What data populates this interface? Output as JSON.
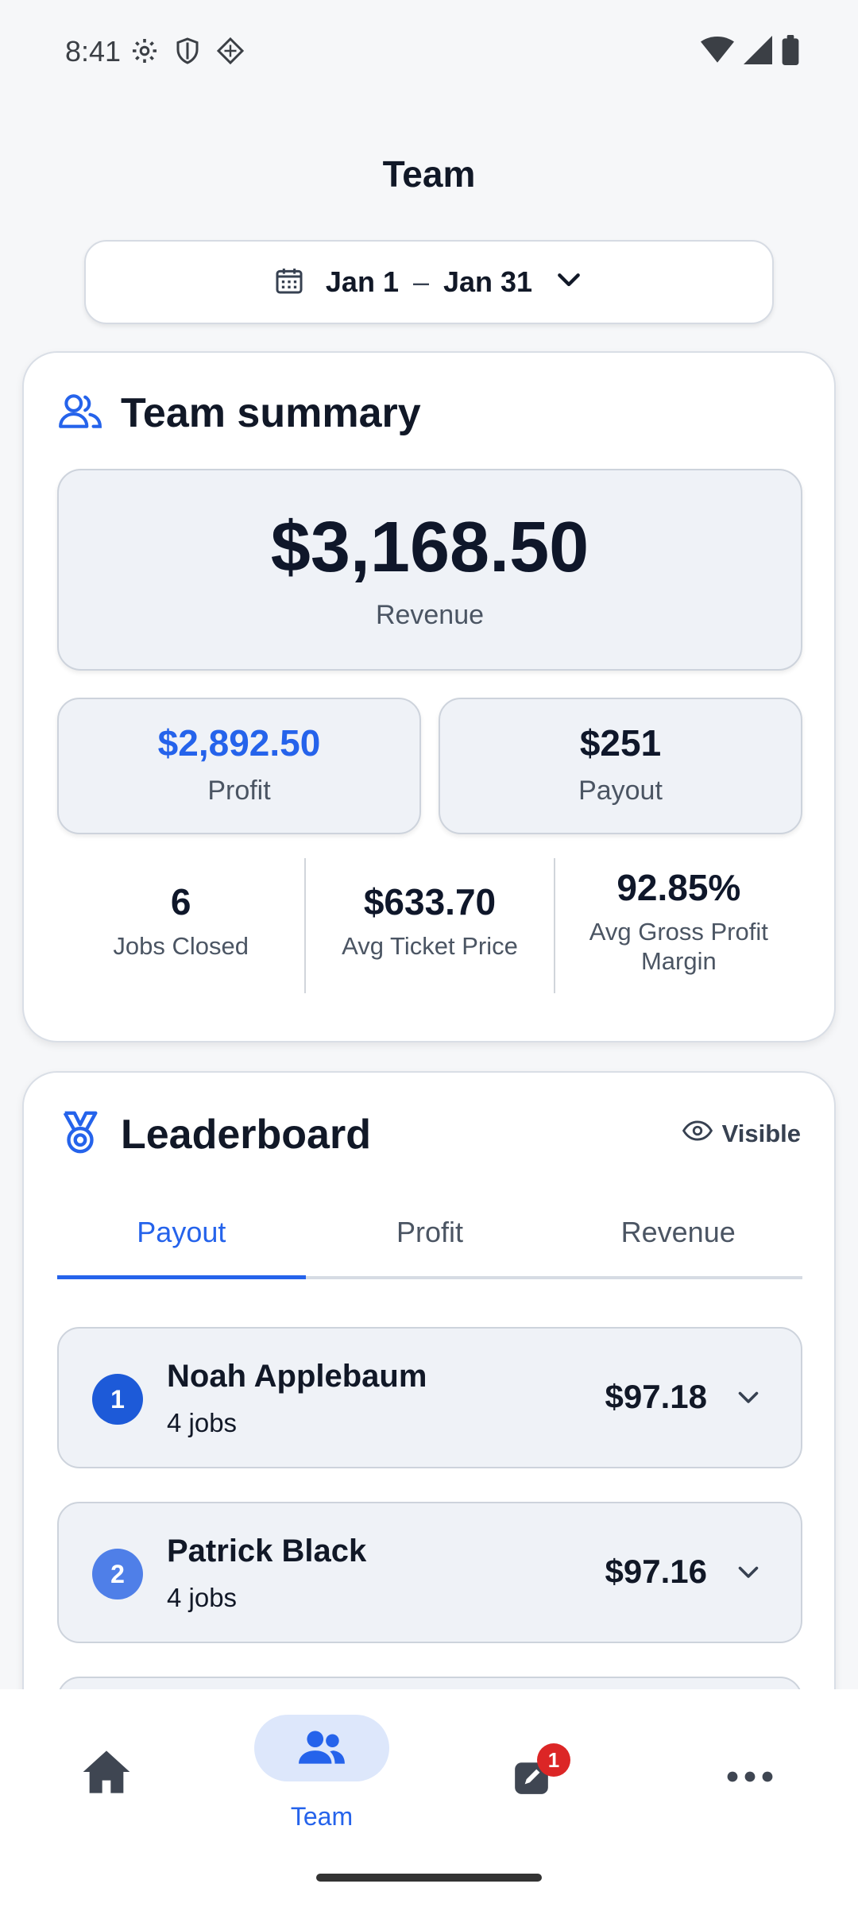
{
  "status_bar": {
    "time": "8:41"
  },
  "header": {
    "title": "Team"
  },
  "date_range": {
    "start": "Jan 1",
    "separator": "–",
    "end": "Jan 31"
  },
  "summary": {
    "title": "Team summary",
    "revenue_amount": "$3,168.50",
    "revenue_label": "Revenue",
    "profit_amount": "$2,892.50",
    "profit_label": "Profit",
    "payout_amount": "$251",
    "payout_label": "Payout",
    "stats": [
      {
        "value": "6",
        "label": "Jobs Closed"
      },
      {
        "value": "$633.70",
        "label": "Avg Ticket Price"
      },
      {
        "value": "92.85%",
        "label": "Avg Gross Profit Margin"
      }
    ]
  },
  "leaderboard": {
    "title": "Leaderboard",
    "visibility_label": "Visible",
    "tabs": [
      {
        "label": "Payout",
        "active": true
      },
      {
        "label": "Profit",
        "active": false
      },
      {
        "label": "Revenue",
        "active": false
      }
    ],
    "entries": [
      {
        "rank": "1",
        "name": "Noah Applebaum",
        "jobs": "4 jobs",
        "amount": "$97.18"
      },
      {
        "rank": "2",
        "name": "Patrick Black",
        "jobs": "4 jobs",
        "amount": "$97.16"
      }
    ]
  },
  "bottom_nav": {
    "team_label": "Team",
    "notification_count": "1"
  },
  "colors": {
    "accent": "#2563eb",
    "rank_1": "#1d5ad8",
    "rank_2": "#4f7fe8",
    "badge": "#dc2626"
  }
}
